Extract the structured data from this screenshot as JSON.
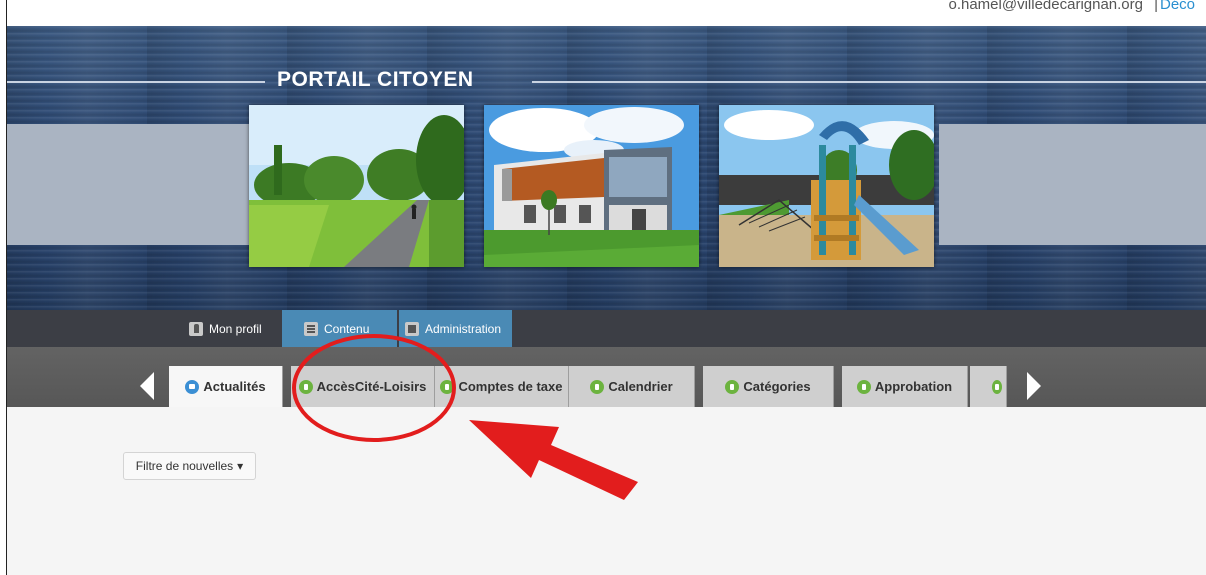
{
  "user": {
    "email": "o.hamel@villedecarignan.org",
    "separator": "|",
    "logout_label": "Déco"
  },
  "banner": {
    "title": "PORTAIL CITOYEN",
    "photos": [
      "cycling-path-photo",
      "modern-building-photo",
      "playground-photo"
    ]
  },
  "admin_menu": {
    "items": [
      {
        "label": "Mon profil",
        "icon": "profile-icon",
        "active": false
      },
      {
        "label": "Contenu",
        "icon": "document-icon",
        "active": true
      },
      {
        "label": "Administration",
        "icon": "admin-icon",
        "active": true
      }
    ]
  },
  "tabs": {
    "items": [
      {
        "label": "Actualités",
        "icon": "home-icon",
        "active": true
      },
      {
        "label": "AccèsCité-Loisirs",
        "icon": "leaf-icon",
        "active": false
      },
      {
        "label": "Comptes de taxe",
        "icon": "leaf-icon",
        "active": false
      },
      {
        "label": "Calendrier",
        "icon": "leaf-icon",
        "active": false
      },
      {
        "label": "Catégories",
        "icon": "leaf-icon",
        "active": false
      },
      {
        "label": "Approbation",
        "icon": "leaf-icon",
        "active": false
      },
      {
        "label": "",
        "icon": "leaf-icon",
        "active": false
      }
    ]
  },
  "content": {
    "filter_label": "Filtre de nouvelles",
    "filter_caret": "▾"
  },
  "colors": {
    "banner_bg": "#2e4a74",
    "admin_bar": "#3c3e45",
    "admin_active": "#4a8ab5",
    "tab_bar": "#5e5e5e",
    "tab_icon": "#6cb33f",
    "home_icon": "#3b8fd4",
    "annotation_red": "#e21d1d"
  }
}
